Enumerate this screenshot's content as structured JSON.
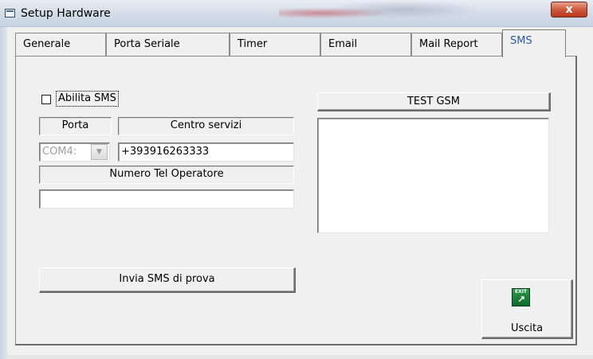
{
  "window": {
    "title": "Setup Hardware",
    "close_glyph": "x"
  },
  "tabs": [
    {
      "label": "Generale"
    },
    {
      "label": "Porta Seriale"
    },
    {
      "label": "Timer"
    },
    {
      "label": "Email"
    },
    {
      "label": "Mail Report"
    },
    {
      "label": "SMS"
    }
  ],
  "active_tab": "SMS",
  "sms": {
    "enable_label": "Abilita SMS",
    "enable_checked": false,
    "porta_label": "Porta",
    "porta_value": "COM4:",
    "centro_servizi_label": "Centro servizi",
    "centro_servizi_value": "+393916263333",
    "numero_tel_label": "Numero Tel Operatore",
    "numero_tel_value": "",
    "send_test_button": "Invia SMS di prova",
    "test_gsm_button": "TEST GSM",
    "gsm_log": ""
  },
  "exit": {
    "icon_text": "EXIT",
    "label": "Uscita"
  },
  "colors": {
    "active_tab_text": "#2c5aa8",
    "exit_icon": "#1a7f36",
    "close_button": "#c94a30"
  }
}
